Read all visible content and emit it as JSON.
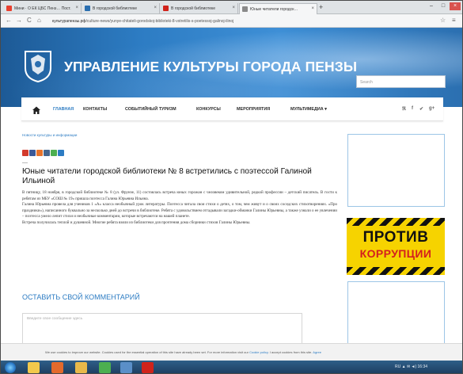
{
  "browser": {
    "tabs": [
      {
        "label": "Мини · О ЕК ЦБС Пенз… Пост.",
        "icon_color": "#e8402f",
        "active": false
      },
      {
        "label": "В городской библиотеке",
        "icon_color": "#2b6fb0",
        "active": false
      },
      {
        "label": "В городской библиотеке",
        "icon_color": "#d0231b",
        "active": false
      },
      {
        "label": "Юные читатели городск…",
        "icon_color": "#8a8a8a",
        "active": true
      }
    ],
    "new_tab_label": "+",
    "window_buttons": {
      "minimize": "–",
      "maximize": "□",
      "close": "×"
    },
    "nav": {
      "back": "←",
      "forward": "→",
      "reload": "C",
      "home": "⌂"
    },
    "url": {
      "host": "культурапензы.рф",
      "path": "/culture-news/yunye-chitateli-gorodskoj-biblioteki-8-vstretilis-s-poetessoj-galinoj-ilinoj"
    },
    "star": "☆",
    "menu": "≡"
  },
  "site": {
    "title": "УПРАВЛЕНИЕ КУЛЬТУРЫ ГОРОДА ПЕНЗЫ",
    "search_placeholder": "Search"
  },
  "menu": {
    "items": [
      {
        "label": "ГЛАВНАЯ",
        "active": true
      },
      {
        "label": "КОНТАКТЫ",
        "active": false
      },
      {
        "label": "СОБЫТИЙНЫЙ ТУРИЗМ",
        "active": false
      },
      {
        "label": "КОНКУРСЫ",
        "active": false
      },
      {
        "label": "МЕРОПРИЯТИЯ",
        "active": false
      },
      {
        "label": "МУЛЬТИМЕДИА ▾",
        "active": false
      }
    ],
    "social": [
      "ℜ",
      "f",
      "✔",
      "g+"
    ]
  },
  "article": {
    "breadcrumb": "Новости культуры и информации",
    "share_colors": [
      "#d33a2c",
      "#3b5998",
      "#e8732a",
      "#45668e",
      "#4caf50",
      "#2d7cc3"
    ],
    "dash": "—",
    "title": "Юные читатели городской библиотеки № 8 встретились с поэтессой Галиной Ильиной",
    "paragraphs": [
      "В пятницу, 18 ноября, в городской библиотеке № 8 (ул. Фрунзе, 11) состоялась встреча юных горожан с человеком удивительной, редкой профессии – детский писатель. В гости к ребятам из МБУ «СОШ № 19» пришла поэтесса Галина Юрьевна Ильина.",
      "Галина Юрьевна провела для учеников 1 «А» класса необычный урок литературы. Поэтесса читала свои стихи о детях, о том, чем живут и о своих соседских стихотворениях. «Про праздники»), написанного буквально за несколько дней до встречи в библиотеке. Ребята с удовольствием отгадывали загадки-обманки Галины Юрьевны, а также узнали о ее увлечении – поэтесса умело лепит стихи и необычные комментарии, которые встречаются на нашей планете.",
      "Встреча получилась теплой и душевной. Многие ребята взяли из библиотеки для прочтения дома сборники стихов Галины Юрьевны."
    ]
  },
  "comments": {
    "title": "ОСТАВИТЬ СВОЙ КОММЕНТАРИЙ",
    "placeholder": "Введите свое сообщение здесь"
  },
  "sidebar": {
    "banner_line1": "ПРОТИВ",
    "banner_line2": "КОРРУПЦИИ"
  },
  "cookie": {
    "text": "We use cookies to improve our website. Cookies used for the essential operation of this site have already been set. For more information visit our",
    "link": "Cookie policy",
    "accept": "I accept cookies from this site.",
    "agree": "Agree"
  },
  "taskbar": {
    "apps": [
      {
        "name": "explorer",
        "color": "#f2c94c"
      },
      {
        "name": "media",
        "color": "#e36a2c"
      },
      {
        "name": "folder",
        "color": "#e8b94a"
      },
      {
        "name": "chrome",
        "color": "#4caf50"
      },
      {
        "name": "photos",
        "color": "#5a8fc8"
      },
      {
        "name": "opera",
        "color": "#d0231b"
      }
    ],
    "tray_text": "RU ▲ ✉ ◄) 16:34"
  }
}
